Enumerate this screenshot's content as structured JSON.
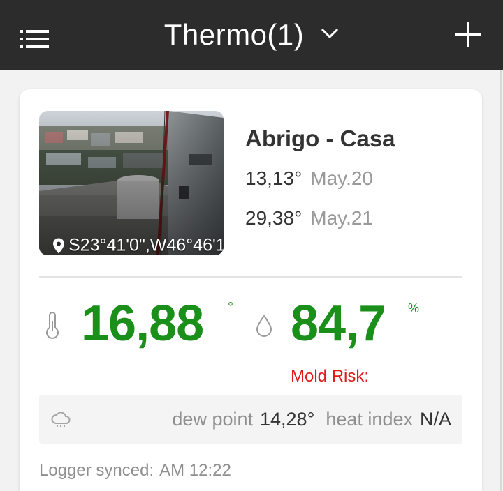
{
  "header": {
    "title": "Thermo(1)",
    "colors": {
      "bar": "#2c2c2c",
      "text": "#ffffff"
    },
    "icons": [
      "menu-icon",
      "chevron-down-icon",
      "plus-icon"
    ]
  },
  "device": {
    "name": "Abrigo - Casa",
    "photo": {
      "location": "S23°41'0\",W46°46'1",
      "icon": "pin-icon"
    },
    "records": [
      {
        "value": "13,13°",
        "date": "May.20"
      },
      {
        "value": "29,38°",
        "date": "May.21"
      }
    ],
    "temperature": {
      "value": "16,88",
      "unit": "°",
      "icon": "thermometer-icon"
    },
    "humidity": {
      "value": "84,7",
      "unit": "%",
      "icon": "water-drop-icon"
    },
    "mold_risk": "Mold Risk:",
    "dew_point_label": "dew point",
    "dew_point_value": "14,28°",
    "heat_index_label": "heat index",
    "heat_index_value": "N/A",
    "dew_icon": "cloud-icon",
    "synced_label": "Logger synced:",
    "synced_time": "AM 12:22",
    "colors": {
      "reading": "#1a8f1a",
      "alert": "#e01a1a",
      "muted": "#9a9a9a"
    }
  }
}
